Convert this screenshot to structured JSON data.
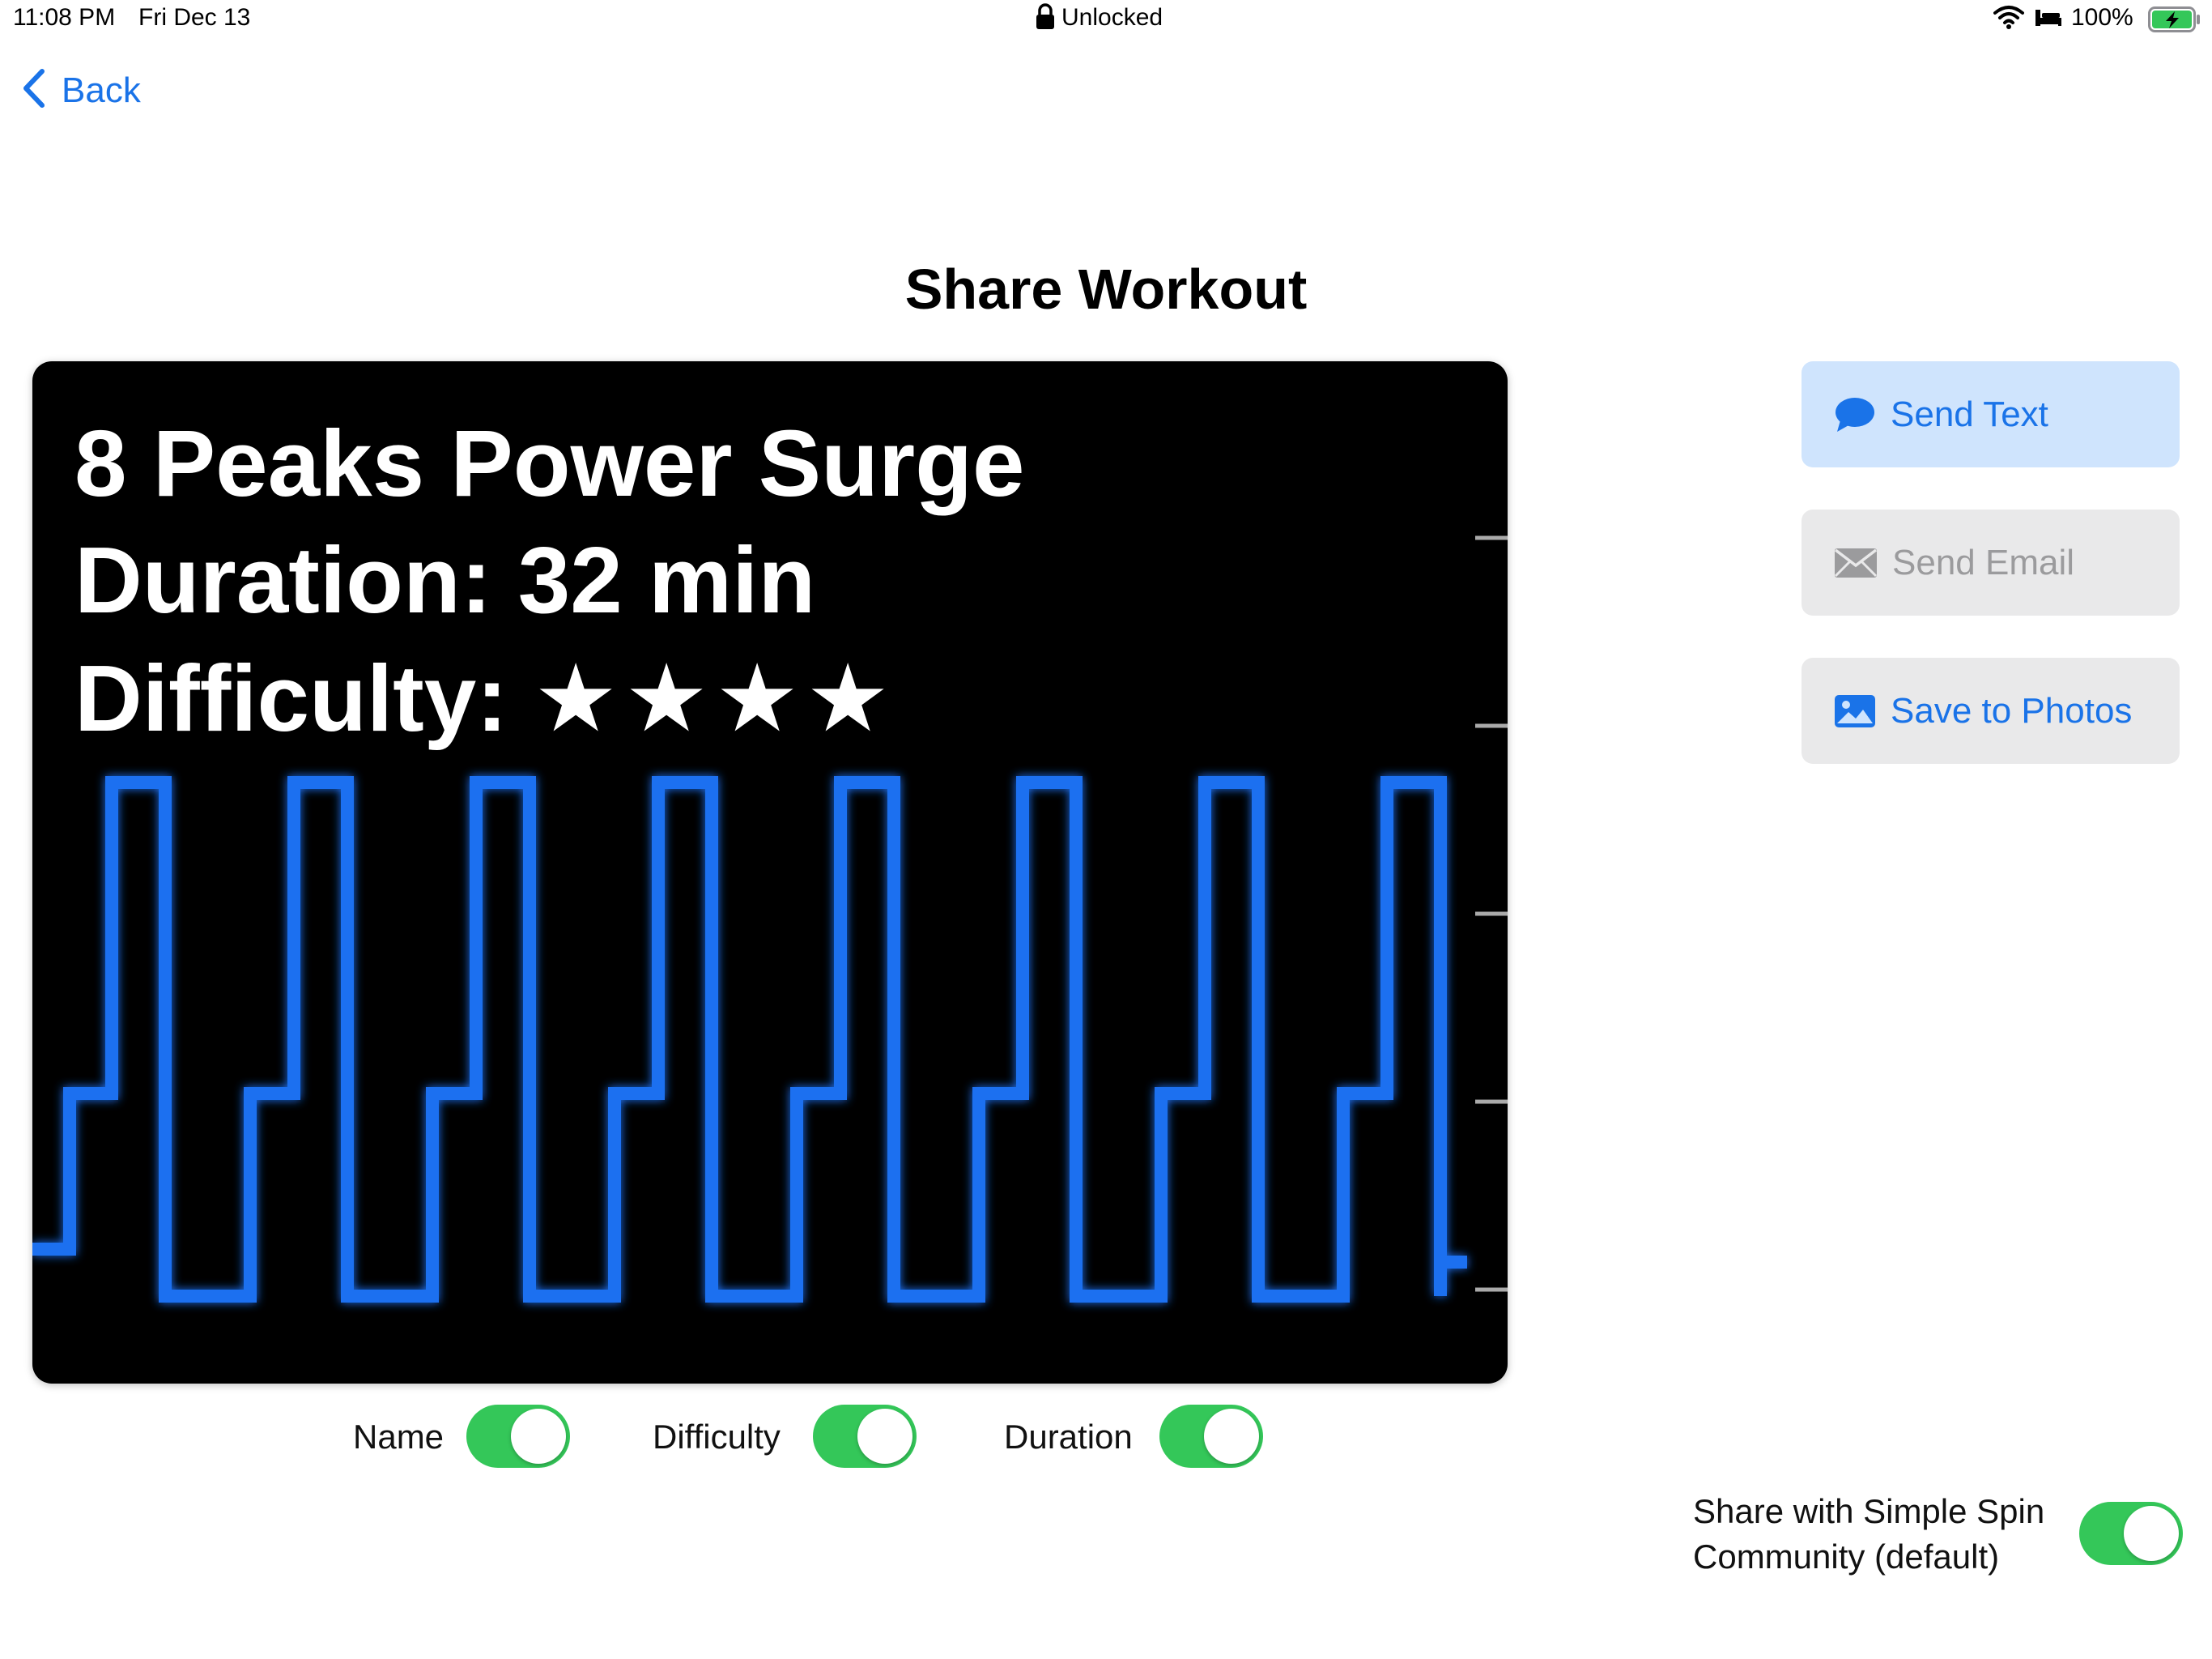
{
  "status_bar": {
    "time": "11:08 PM",
    "date": "Fri Dec 13",
    "lock_label": "Unlocked",
    "battery": "100%"
  },
  "nav": {
    "back_label": "Back"
  },
  "title": "Share Workout",
  "preview": {
    "name": "8 Peaks Power Surge",
    "duration": "Duration: 32 min",
    "difficulty_label": "Difficulty:",
    "difficulty_stars": "★★★★",
    "difficulty_rating": 4
  },
  "toggles": {
    "name": {
      "label": "Name",
      "on": true
    },
    "difficulty": {
      "label": "Difficulty",
      "on": true
    },
    "duration": {
      "label": "Duration",
      "on": true
    }
  },
  "actions": {
    "send_text": "Send Text",
    "send_email": "Send Email",
    "save_photos": "Save to Photos"
  },
  "community": {
    "line1": "Share with Simple Spin",
    "line2": "Community (default)",
    "on": true
  },
  "colors": {
    "accent": "#1a73e8",
    "toggle_on": "#34c759",
    "chart_line": "#1e6ff0"
  }
}
